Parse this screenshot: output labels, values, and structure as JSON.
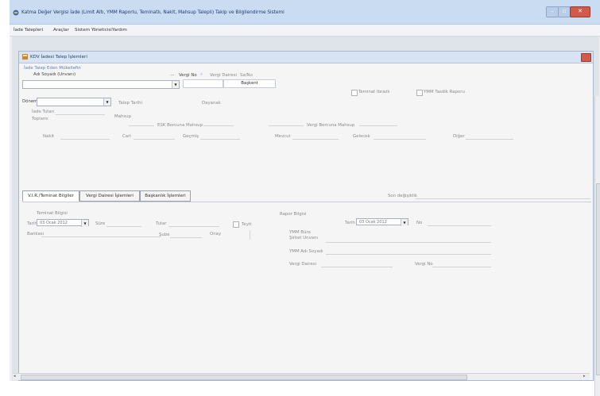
{
  "window": {
    "title": "Katma Değer Vergisi İade (Limit Altı, YMM Raporlu, Teminatlı, Nakit, Mahsup Talepli) Takip ve Bilgilendirme Sistemi",
    "icon": "app-icon"
  },
  "menubar": {
    "items": [
      {
        "label": "İade Talepleri"
      },
      {
        "label": "Araçlar"
      },
      {
        "label": "Sistem Yöneticisi"
      },
      {
        "label": "Yardım"
      }
    ]
  },
  "child_window": {
    "title": "KDV İadesi Talep İşlemleri"
  },
  "form": {
    "header_link": "İade Talep Eden Mükellefin",
    "name_label": "Adı Soyadı (Unvanı)",
    "vergi_no_label": "Vergi No",
    "vergi_dairesi_label": "Vergi Dairesi",
    "sefhe_label": "Sa/No",
    "vd_value": "Başkent",
    "teminat_label": "Teminat Ibrazlı",
    "ymm_tasdik_label": "YMM Tasdik Raporu",
    "donem_label": "Dönemi",
    "talep_tarihi_label": "Talep Tarihi",
    "dayanak_label": "Dayanak",
    "iade_tutari_label": "İade Tutarı",
    "toplam_label": "Toplamı",
    "mahsup_label": "Mahsup",
    "esk_group_label": "ESK Borcuna Mahsup",
    "vergi_group_label": "Vergi Borcuna Mahsup",
    "nakit_label": "Nakit",
    "cari_label": "Cari",
    "gecmis_label": "Geçmiş",
    "mevcut_label": "Mevcut",
    "gelecek_label": "Gelecek",
    "diger_label": "Diğer"
  },
  "tabs": [
    {
      "label": "V.I.R./Teminat Bilgiler"
    },
    {
      "label": "Vergi Dairesi İşlemleri"
    },
    {
      "label": "Başkanlık İşlemleri"
    }
  ],
  "tab_extra_label": "Son değişiklik",
  "teminat": {
    "group_label": "Teminat Bilgisi",
    "tarih_label": "Tarih",
    "tarih_value": "03 Ocak 2012",
    "sure_label": "Süre",
    "tutar_label": "Tutar",
    "teyit_label": "Teyit",
    "bankasi_label": "Bankası",
    "sube_label": "Şube",
    "onay_label": "Onay"
  },
  "rapor": {
    "group_label": "Rapor Bilgisi",
    "tarih_label": "Tarih",
    "tarih_value": "03 Ocak 2012",
    "no_label": "No",
    "ymm_buro_label": "YMM Büro Şirket Unvanı",
    "ymm_adsoyad_label": "YMM Adı Soyadı",
    "vergi_dairesi_label": "Vergi Dairesi",
    "vergi_no_label": "Vergi No"
  },
  "colors": {
    "titlebar": "#c9dcf2",
    "close_button": "#d05b4a",
    "link_blue": "#5a7fc4"
  }
}
